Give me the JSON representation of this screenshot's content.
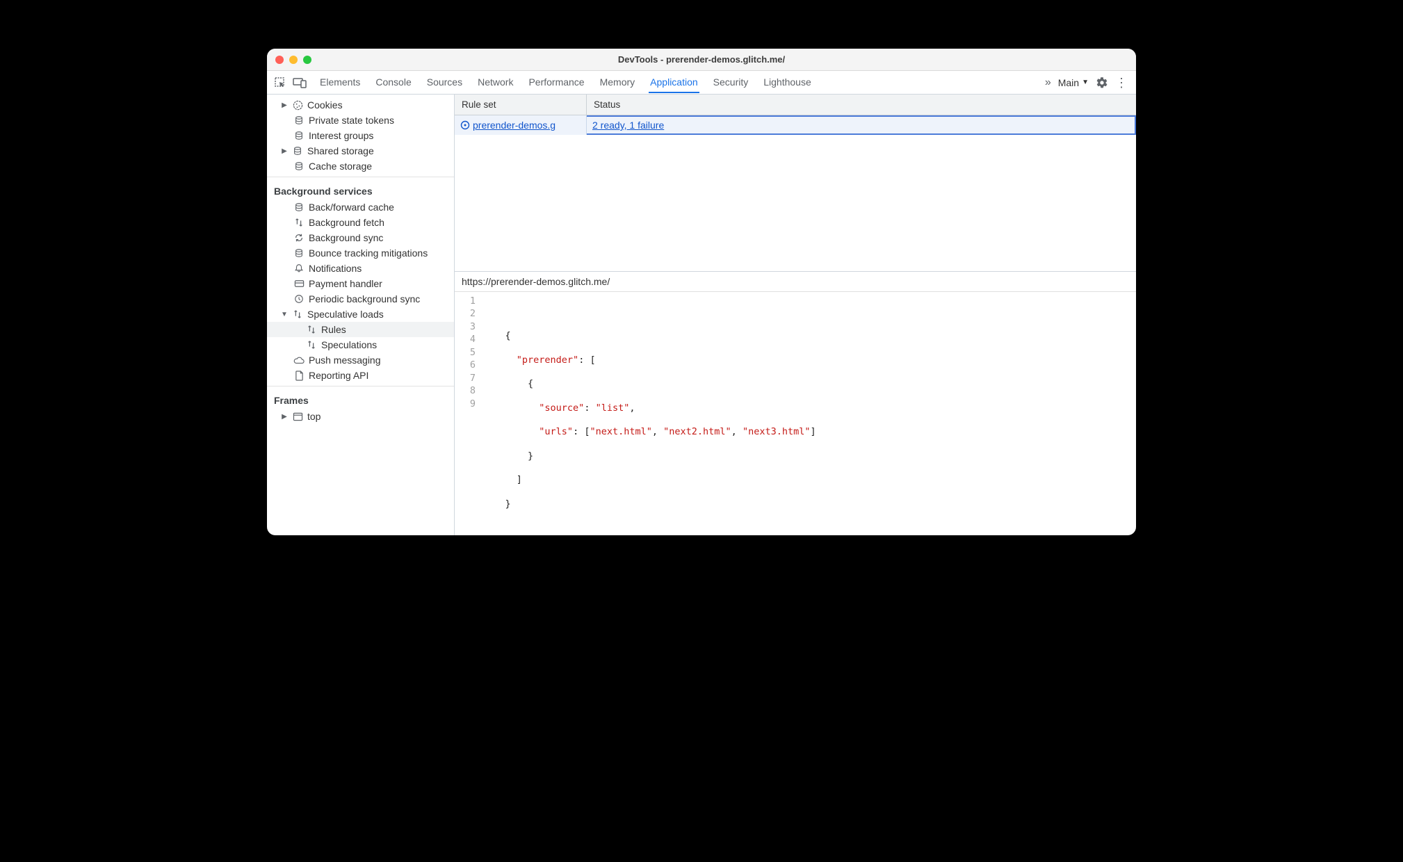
{
  "window": {
    "title": "DevTools - prerender-demos.glitch.me/"
  },
  "tabs": {
    "elements": "Elements",
    "console": "Console",
    "sources": "Sources",
    "network": "Network",
    "performance": "Performance",
    "memory": "Memory",
    "application": "Application",
    "security": "Security",
    "lighthouse": "Lighthouse"
  },
  "toolbar": {
    "main": "Main"
  },
  "sidebar": {
    "storage": {
      "cookies": "Cookies",
      "private_state": "Private state tokens",
      "interest_groups": "Interest groups",
      "shared_storage": "Shared storage",
      "cache_storage": "Cache storage"
    },
    "bg_header": "Background services",
    "bg": {
      "bf_cache": "Back/forward cache",
      "bg_fetch": "Background fetch",
      "bg_sync": "Background sync",
      "bounce": "Bounce tracking mitigations",
      "notifications": "Notifications",
      "payment": "Payment handler",
      "periodic": "Periodic background sync",
      "speculative": "Speculative loads",
      "rules": "Rules",
      "speculations": "Speculations",
      "push": "Push messaging",
      "reporting": "Reporting API"
    },
    "frames_header": "Frames",
    "frames": {
      "top": "top"
    }
  },
  "table": {
    "col_rule": "Rule set",
    "col_status": "Status",
    "row0": {
      "rule": "prerender-demos.g",
      "status": "2 ready, 1 failure"
    }
  },
  "detail": {
    "url": "https://prerender-demos.glitch.me/",
    "code_lines": [
      "1",
      "2",
      "3",
      "4",
      "5",
      "6",
      "7",
      "8",
      "9"
    ],
    "json": {
      "k_prerender": "\"prerender\"",
      "k_source": "\"source\"",
      "v_source": "\"list\"",
      "k_urls": "\"urls\"",
      "u0": "\"next.html\"",
      "u1": "\"next2.html\"",
      "u2": "\"next3.html\""
    }
  }
}
